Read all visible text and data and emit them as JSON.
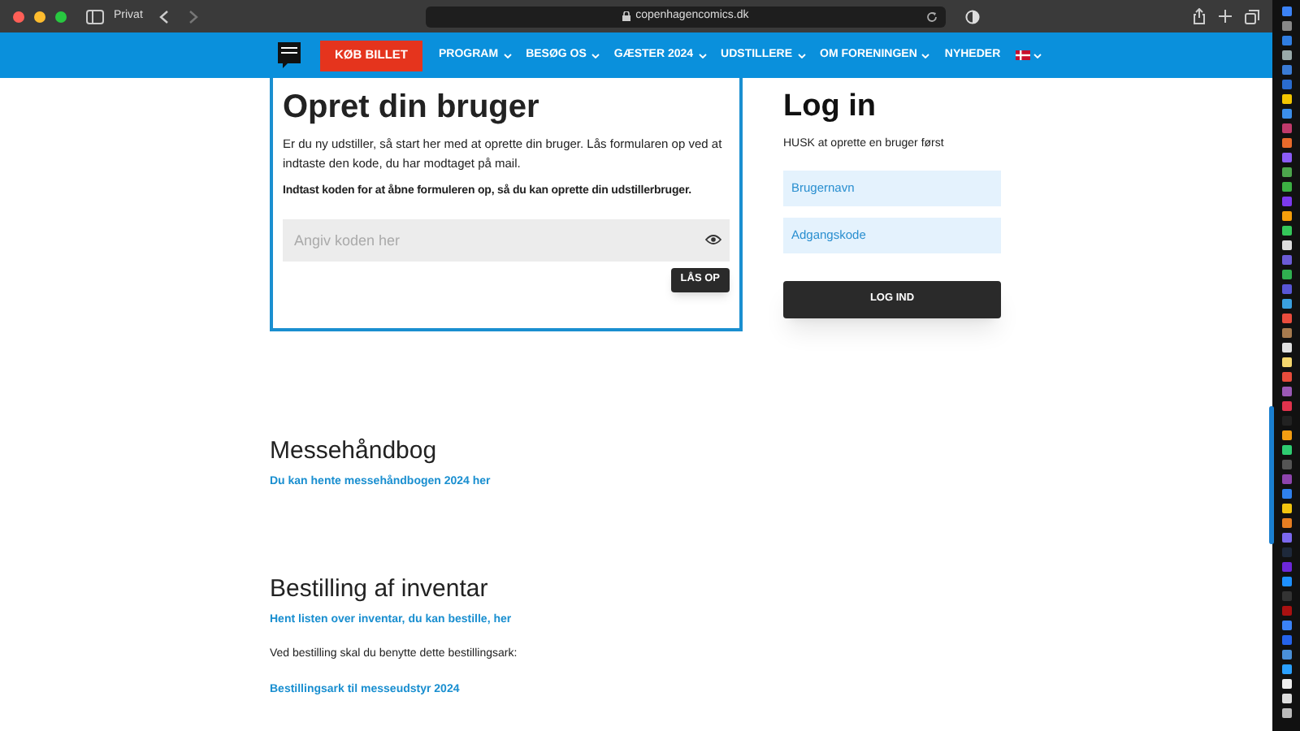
{
  "browser": {
    "profile": "Privat",
    "url": "copenhagencomics.dk"
  },
  "nav": {
    "buy_button": "KØB BILLET",
    "items": [
      {
        "label": "PROGRAM",
        "dropdown": true
      },
      {
        "label": "BESØG OS",
        "dropdown": true
      },
      {
        "label": "GÆSTER 2024",
        "dropdown": true
      },
      {
        "label": "UDSTILLERE",
        "dropdown": true
      },
      {
        "label": "OM FORENINGEN",
        "dropdown": true
      },
      {
        "label": "NYHEDER",
        "dropdown": false
      }
    ]
  },
  "create_user": {
    "title": "Opret din bruger",
    "intro": "Er du ny udstiller, så start her med at oprette din bruger. Lås formularen op ved at indtaste den kode, du har modtaget på mail.",
    "instruction": "Indtast koden for at åbne formuleren op, så du kan oprette din udstillerbruger.",
    "code_field": {
      "placeholder": "Angiv koden her"
    },
    "unlock_button": "LÅS OP"
  },
  "login": {
    "title": "Log in",
    "note": "HUSK at oprette en bruger først",
    "username": {
      "placeholder": "Brugernavn"
    },
    "password": {
      "placeholder": "Adgangskode"
    },
    "button": "LOG IND"
  },
  "sections": [
    {
      "title": "Messehåndbog",
      "items": [
        {
          "kind": "link",
          "text": "Du kan hente messehåndbogen 2024 her"
        }
      ]
    },
    {
      "title": "Bestilling af inventar",
      "items": [
        {
          "kind": "link",
          "text": "Hent listen over inventar, du kan bestille, her"
        },
        {
          "kind": "text",
          "text": "Ved bestilling skal du benytte dette bestillingsark:"
        },
        {
          "kind": "link",
          "text": "Bestillingsark til messeudstyr 2024"
        }
      ]
    }
  ]
}
